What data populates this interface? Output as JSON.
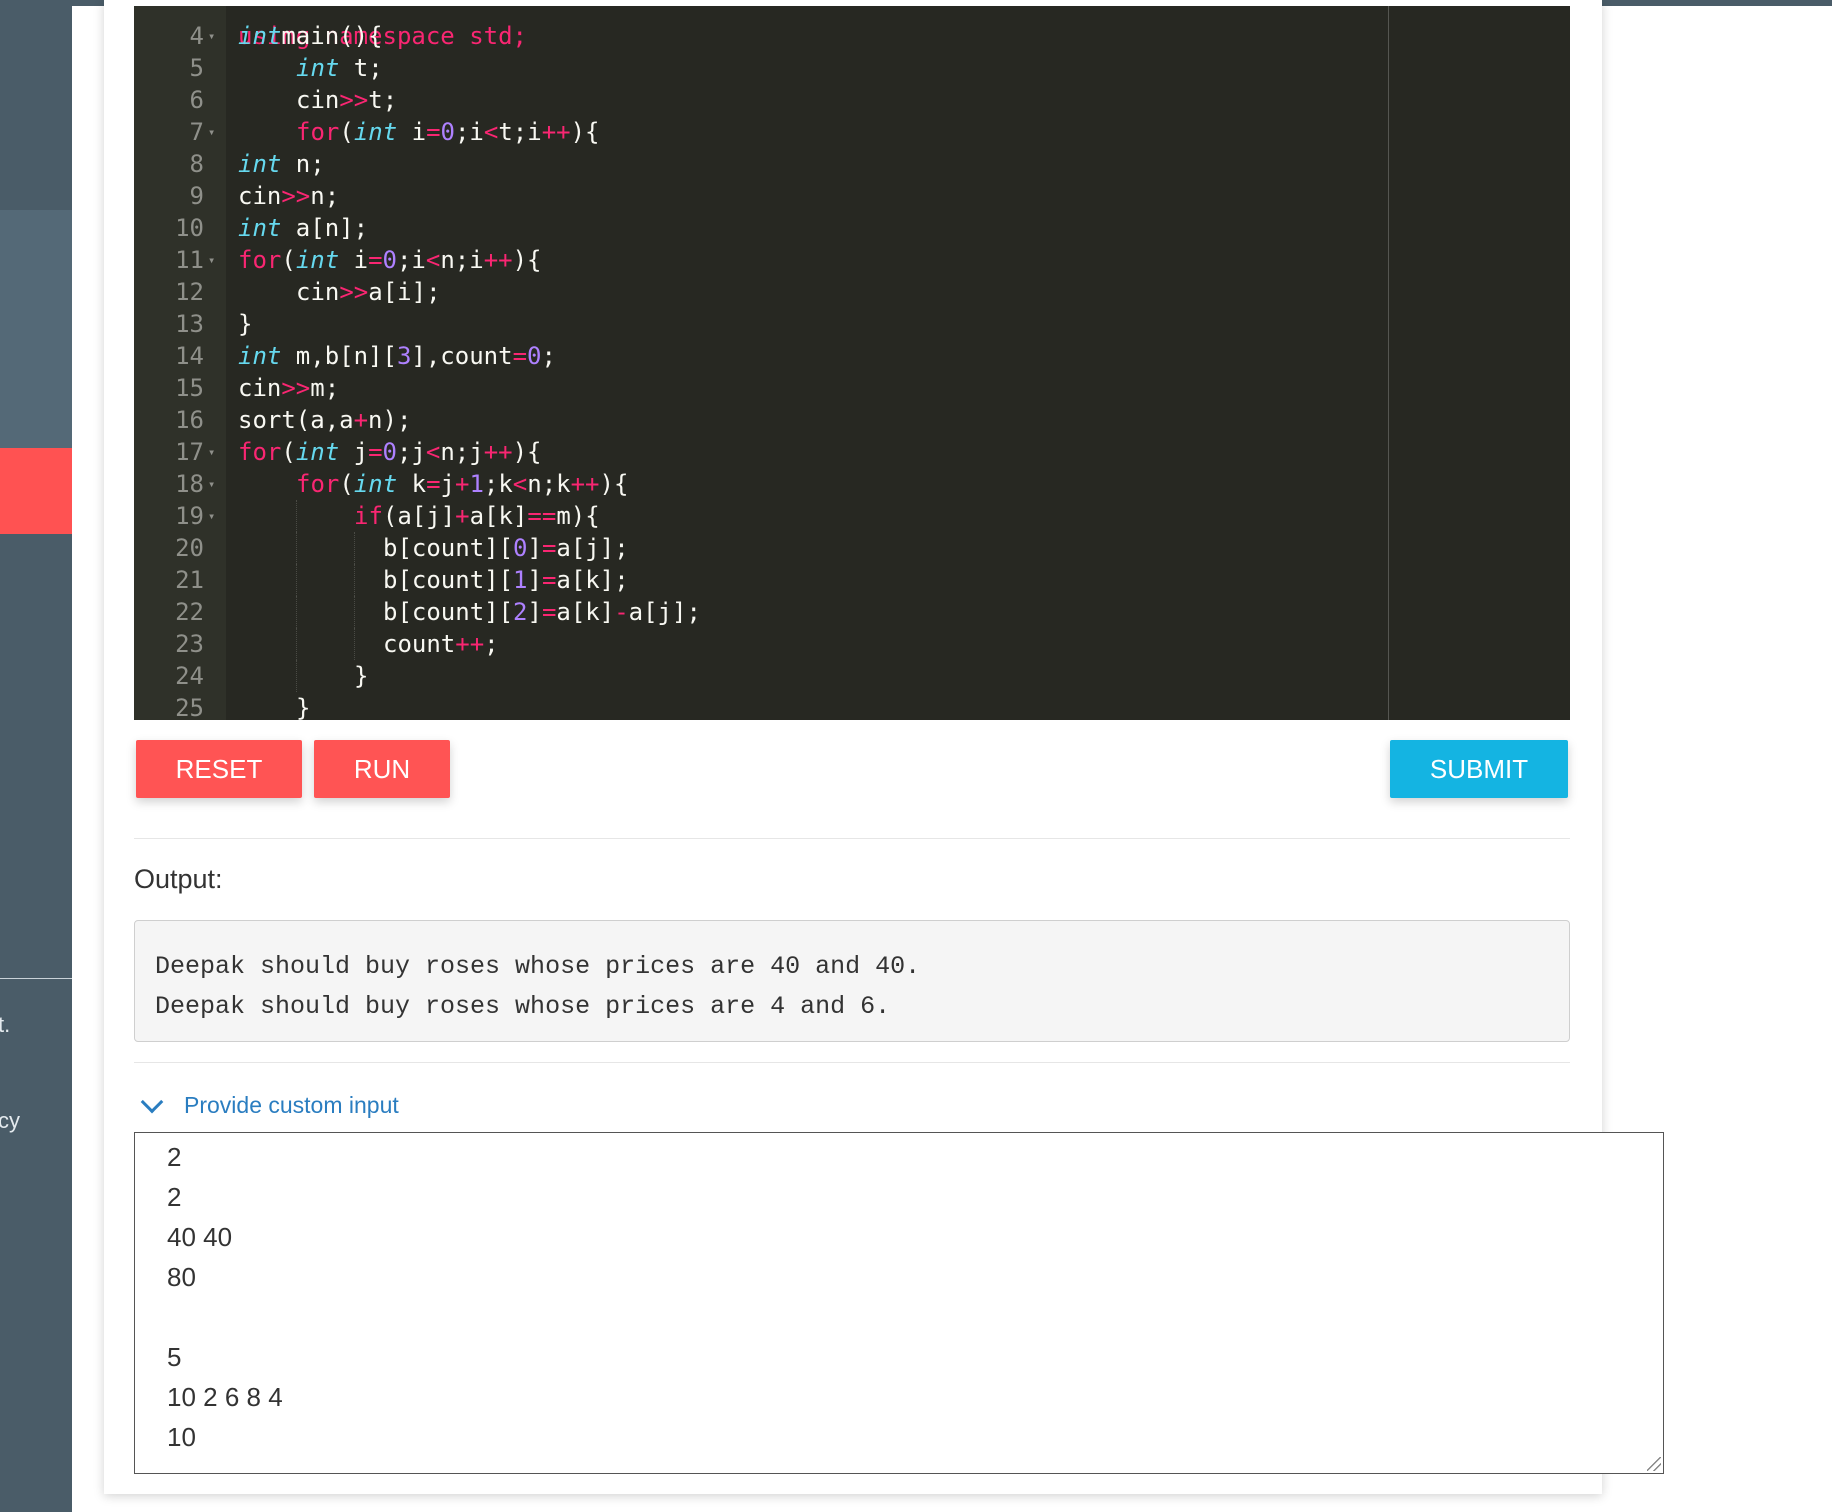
{
  "sidebar": {
    "snippet_1": "t.",
    "snippet_2": "cy"
  },
  "editor": {
    "partial_top_line": "using namespace std;",
    "lines": [
      {
        "n": "4",
        "fold": true,
        "indent": 0,
        "tokens": [
          [
            "ty",
            "int"
          ],
          [
            "",
            "main(){"
          ]
        ]
      },
      {
        "n": "5",
        "fold": false,
        "indent": 1,
        "tokens": [
          [
            "ty",
            "int"
          ],
          [
            "",
            " t;"
          ]
        ]
      },
      {
        "n": "6",
        "fold": false,
        "indent": 1,
        "tokens": [
          [
            "",
            "cin"
          ],
          [
            "kw",
            ">>"
          ],
          [
            "",
            "t;"
          ]
        ]
      },
      {
        "n": "7",
        "fold": true,
        "indent": 1,
        "tokens": [
          [
            "kw",
            "for"
          ],
          [
            "",
            "("
          ],
          [
            "ty",
            "int"
          ],
          [
            "",
            " i"
          ],
          [
            "kw",
            "="
          ],
          [
            "nu",
            "0"
          ],
          [
            "",
            ";i"
          ],
          [
            "kw",
            "<"
          ],
          [
            "",
            "t;i"
          ],
          [
            "kw",
            "++"
          ],
          [
            "",
            "){"
          ]
        ]
      },
      {
        "n": "8",
        "fold": false,
        "indent": 0,
        "tokens": [
          [
            "ty",
            "int"
          ],
          [
            "",
            " n;"
          ]
        ]
      },
      {
        "n": "9",
        "fold": false,
        "indent": 0,
        "tokens": [
          [
            "",
            "cin"
          ],
          [
            "kw",
            ">>"
          ],
          [
            "",
            "n;"
          ]
        ]
      },
      {
        "n": "10",
        "fold": false,
        "indent": 0,
        "tokens": [
          [
            "ty",
            "int"
          ],
          [
            "",
            " a[n];"
          ]
        ]
      },
      {
        "n": "11",
        "fold": true,
        "indent": 0,
        "tokens": [
          [
            "kw",
            "for"
          ],
          [
            "",
            "("
          ],
          [
            "ty",
            "int"
          ],
          [
            "",
            " i"
          ],
          [
            "kw",
            "="
          ],
          [
            "nu",
            "0"
          ],
          [
            "",
            ";i"
          ],
          [
            "kw",
            "<"
          ],
          [
            "",
            "n;i"
          ],
          [
            "kw",
            "++"
          ],
          [
            "",
            "){"
          ]
        ]
      },
      {
        "n": "12",
        "fold": false,
        "indent": 1,
        "tokens": [
          [
            "",
            "cin"
          ],
          [
            "kw",
            ">>"
          ],
          [
            "",
            "a[i];"
          ]
        ]
      },
      {
        "n": "13",
        "fold": false,
        "indent": 0,
        "tokens": [
          [
            "",
            "}"
          ]
        ]
      },
      {
        "n": "14",
        "fold": false,
        "indent": 0,
        "tokens": [
          [
            "ty",
            "int"
          ],
          [
            "",
            " m,b[n]["
          ],
          [
            "nu",
            "3"
          ],
          [
            "",
            "],count"
          ],
          [
            "kw",
            "="
          ],
          [
            "nu",
            "0"
          ],
          [
            "",
            ";"
          ]
        ]
      },
      {
        "n": "15",
        "fold": false,
        "indent": 0,
        "tokens": [
          [
            "",
            "cin"
          ],
          [
            "kw",
            ">>"
          ],
          [
            "",
            "m;"
          ]
        ]
      },
      {
        "n": "16",
        "fold": false,
        "indent": 0,
        "tokens": [
          [
            "",
            "sort(a,a"
          ],
          [
            "kw",
            "+"
          ],
          [
            "",
            "n);"
          ]
        ]
      },
      {
        "n": "17",
        "fold": true,
        "indent": 0,
        "tokens": [
          [
            "kw",
            "for"
          ],
          [
            "",
            "("
          ],
          [
            "ty",
            "int"
          ],
          [
            "",
            " j"
          ],
          [
            "kw",
            "="
          ],
          [
            "nu",
            "0"
          ],
          [
            "",
            ";j"
          ],
          [
            "kw",
            "<"
          ],
          [
            "",
            "n;j"
          ],
          [
            "kw",
            "++"
          ],
          [
            "",
            "){"
          ]
        ]
      },
      {
        "n": "18",
        "fold": true,
        "indent": 1,
        "tokens": [
          [
            "kw",
            "for"
          ],
          [
            "",
            "("
          ],
          [
            "ty",
            "int"
          ],
          [
            "",
            " k"
          ],
          [
            "kw",
            "="
          ],
          [
            "",
            "j"
          ],
          [
            "kw",
            "+"
          ],
          [
            "nu",
            "1"
          ],
          [
            "",
            ";k"
          ],
          [
            "kw",
            "<"
          ],
          [
            "",
            "n;k"
          ],
          [
            "kw",
            "++"
          ],
          [
            "",
            "){"
          ]
        ]
      },
      {
        "n": "19",
        "fold": true,
        "indent": 2,
        "tokens": [
          [
            "kw",
            "if"
          ],
          [
            "",
            "(a[j]"
          ],
          [
            "kw",
            "+"
          ],
          [
            "",
            "a[k]"
          ],
          [
            "kw",
            "=="
          ],
          [
            "",
            "m){"
          ]
        ]
      },
      {
        "n": "20",
        "fold": false,
        "indent": 2.5,
        "tokens": [
          [
            "",
            "b[count]["
          ],
          [
            "nu",
            "0"
          ],
          [
            "",
            "]"
          ],
          [
            "kw",
            "="
          ],
          [
            "",
            "a[j];"
          ]
        ]
      },
      {
        "n": "21",
        "fold": false,
        "indent": 2.5,
        "tokens": [
          [
            "",
            "b[count]["
          ],
          [
            "nu",
            "1"
          ],
          [
            "",
            "]"
          ],
          [
            "kw",
            "="
          ],
          [
            "",
            "a[k];"
          ]
        ]
      },
      {
        "n": "22",
        "fold": false,
        "indent": 2.5,
        "tokens": [
          [
            "",
            "b[count]["
          ],
          [
            "nu",
            "2"
          ],
          [
            "",
            "]"
          ],
          [
            "kw",
            "="
          ],
          [
            "",
            "a[k]"
          ],
          [
            "kw",
            "-"
          ],
          [
            "",
            "a[j];"
          ]
        ]
      },
      {
        "n": "23",
        "fold": false,
        "indent": 2.5,
        "tokens": [
          [
            "",
            "count"
          ],
          [
            "kw",
            "++"
          ],
          [
            "",
            ";"
          ]
        ]
      },
      {
        "n": "24",
        "fold": false,
        "indent": 2,
        "tokens": [
          [
            "",
            "}"
          ]
        ]
      },
      {
        "n": "25",
        "fold": false,
        "indent": 1,
        "tokens": [
          [
            "",
            "}"
          ]
        ]
      }
    ]
  },
  "buttons": {
    "reset": "RESET",
    "run": "RUN",
    "submit": "SUBMIT"
  },
  "output": {
    "label": "Output:",
    "lines": [
      "Deepak should buy roses whose prices are 40 and 40.",
      "Deepak should buy roses whose prices are 4 and 6."
    ]
  },
  "custom_input": {
    "toggle_label": "Provide custom input",
    "lines": [
      "2",
      "2",
      "40 40",
      "80",
      "",
      "5",
      "10 2 6 8 4",
      "10"
    ]
  },
  "colors": {
    "accent_red": "#ff5454",
    "accent_blue": "#14b4e2",
    "editor_bg": "#272822"
  }
}
